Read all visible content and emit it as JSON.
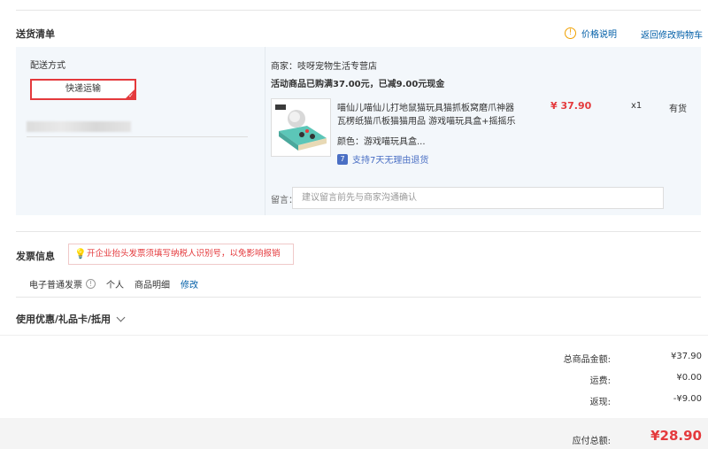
{
  "section": {
    "title": "送货清单",
    "price_info_label": "价格说明",
    "back_to_cart": "返回修改购物车"
  },
  "shipping": {
    "label": "配送方式",
    "method": "快递运输"
  },
  "store": {
    "merchant": "商家：吱呀宠物生活专营店",
    "promo": "活动商品已购满37.00元，已减9.00元现金"
  },
  "product": {
    "name_line1": "喵仙儿喵仙儿打地鼠猫玩具猫抓板窝磨爪神器",
    "name_line2": "瓦楞纸猫爪板猫猫用品 游戏喵玩具盒+摇摇乐",
    "color": "颜色：游戏喵玩具盒...",
    "returns": "支持7天无理由退货",
    "price": "¥ 37.90",
    "qty": "x1",
    "stock": "有货"
  },
  "note": {
    "label": "留言：",
    "placeholder": "建议留言前先与商家沟通确认"
  },
  "invoice": {
    "title": "发票信息",
    "tip": "开企业抬头发票须填写纳税人识别号，以免影响报销",
    "type": "电子普通发票",
    "holder": "个人",
    "content": "商品明细",
    "edit": "修改"
  },
  "coupon": {
    "title": "使用优惠/礼品卡/抵用"
  },
  "summary": {
    "goods_label": "总商品金额:",
    "goods_value": "¥37.90",
    "freight_label": "运费:",
    "freight_value": "¥0.00",
    "rebate_label": "返现:",
    "rebate_value": "-¥9.00",
    "total_label": "应付总额:",
    "total_value": "¥28.90"
  },
  "colors": {
    "accent": "#e4393c",
    "link": "#005ea7",
    "panel": "#f3f7fb"
  }
}
